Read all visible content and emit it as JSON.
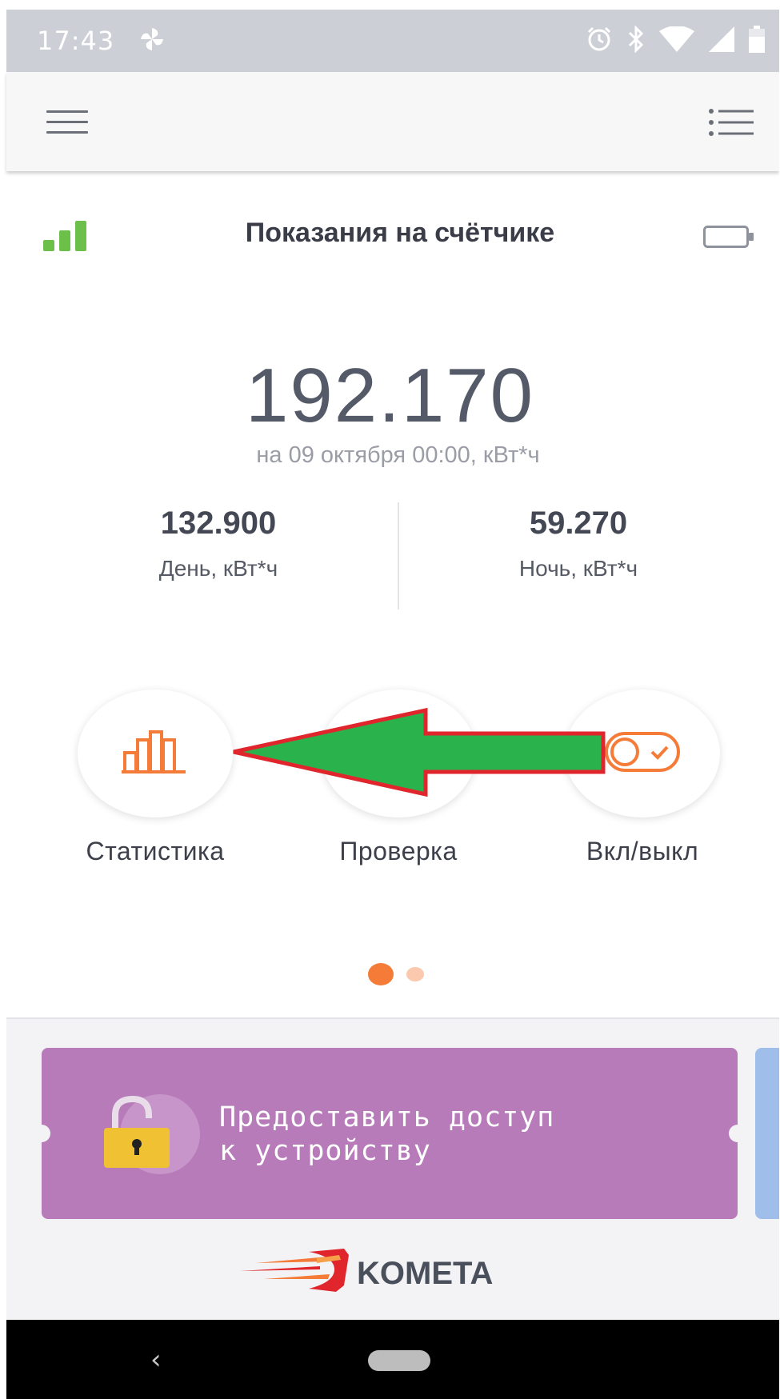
{
  "status_bar": {
    "time": "17:43"
  },
  "header": {
    "title": "Показания на счётчике"
  },
  "reading": {
    "value": "192.170",
    "subtitle": "на 09 октября 00:00, кВт*ч",
    "day": {
      "value": "132.900",
      "label": "День, кВт*ч"
    },
    "night": {
      "value": "59.270",
      "label": "Ночь, кВт*ч"
    }
  },
  "actions": [
    {
      "label": "Статистика",
      "icon": "bar-chart-icon"
    },
    {
      "label": "Проверка",
      "icon": "check-icon"
    },
    {
      "label": "Вкл/выкл",
      "icon": "toggle-icon"
    }
  ],
  "pager": {
    "total": 2,
    "active": 1
  },
  "access_card": {
    "line1": "Предоставить доступ",
    "line2": "к устройству",
    "icon": "lock-icon"
  },
  "logo": {
    "text": "KOMETA"
  },
  "colors": {
    "accent": "#f57c38",
    "signal": "#6cc04a",
    "card": "#b77bba",
    "arrow_fill": "#2ab34c",
    "arrow_stroke": "#e0262c"
  }
}
